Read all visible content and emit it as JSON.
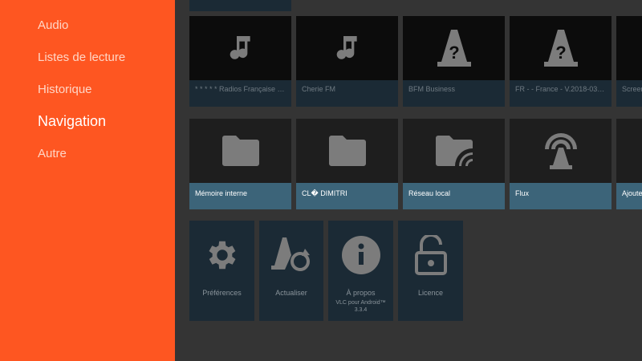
{
  "sidebar": {
    "items": [
      {
        "label": "Audio"
      },
      {
        "label": "Listes de lecture"
      },
      {
        "label": "Historique"
      },
      {
        "label": "Navigation",
        "active": true
      },
      {
        "label": "Autre"
      }
    ]
  },
  "history": [
    {
      "label": "* * * * * Radios Française * *..",
      "icon": "music-note-icon"
    },
    {
      "label": "Cherie FM",
      "icon": "music-note-icon"
    },
    {
      "label": "BFM Business",
      "icon": "unknown-cone-icon"
    },
    {
      "label": "FR - - France - V.2018-03 - PC...",
      "icon": "unknown-cone-icon"
    },
    {
      "label": "Screen",
      "icon": "none"
    }
  ],
  "browsing": [
    {
      "label": "Mémoire interne",
      "icon": "folder-icon"
    },
    {
      "label": "CL� DIMITRI",
      "icon": "folder-icon"
    },
    {
      "label": "Réseau local",
      "icon": "network-folder-icon"
    },
    {
      "label": "Flux",
      "icon": "stream-antenna-icon"
    },
    {
      "label": "Ajouter",
      "icon": "none"
    }
  ],
  "other": [
    {
      "label": "Préférences",
      "icon": "gear-icon"
    },
    {
      "label": "Actualiser",
      "icon": "refresh-cone-icon"
    },
    {
      "label": "À propos",
      "sub1": "VLC pour Android™",
      "sub2": "3.3.4",
      "icon": "info-icon"
    },
    {
      "label": "Licence",
      "icon": "unlock-icon"
    }
  ],
  "colors": {
    "accent": "#fe5621",
    "label_focus": "#3c6479",
    "card": "#1b2a35"
  }
}
